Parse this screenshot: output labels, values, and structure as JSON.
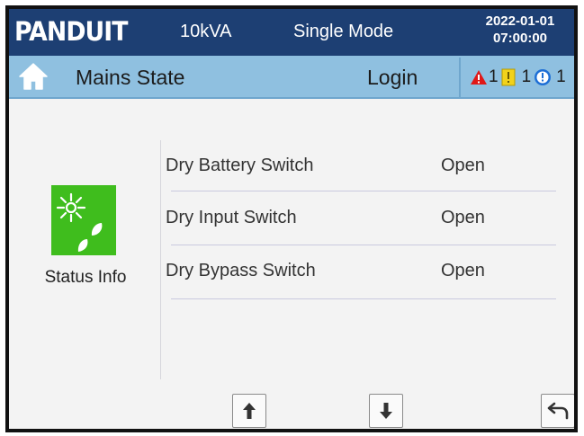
{
  "header": {
    "brand": "PANDUIT",
    "power_rating": "10kVA",
    "mode": "Single Mode",
    "date": "2022-01-01",
    "time": "07:00:00"
  },
  "subheader": {
    "title": "Mains State",
    "login_label": "Login",
    "alarms": [
      {
        "icon": "warning-triangle-icon",
        "color": "#e01818",
        "count": "1"
      },
      {
        "icon": "exclamation-square-icon",
        "color": "#f2d21b",
        "count": "1"
      },
      {
        "icon": "info-circle-icon",
        "color": "#1e6fd6",
        "count": "1"
      }
    ]
  },
  "sidebar": {
    "status_label": "Status Info",
    "status_icon": "sun-leaf-icon",
    "icon_color": "#3fbd1d"
  },
  "rows": [
    {
      "name": "Dry Battery Switch",
      "value": "Open"
    },
    {
      "name": "Dry Input Switch",
      "value": "Open"
    },
    {
      "name": "Dry Bypass Switch",
      "value": "Open"
    }
  ],
  "footer": {
    "buttons": [
      "up-arrow-icon",
      "down-arrow-icon",
      "back-arrow-icon"
    ]
  },
  "colors": {
    "header_bg": "#1d3f73",
    "subheader_bg": "#8fc0e0",
    "content_bg": "#f3f3f3"
  }
}
